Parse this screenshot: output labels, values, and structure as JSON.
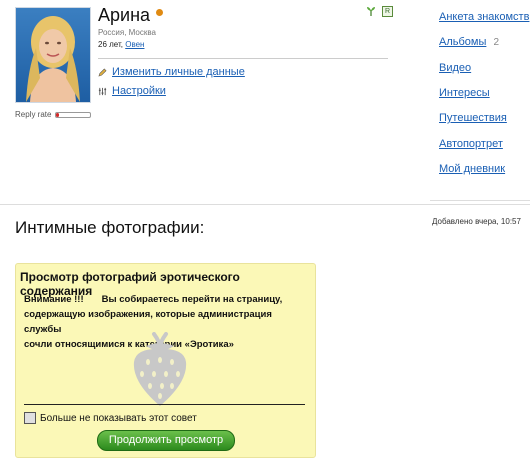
{
  "profile": {
    "name": "Арина",
    "location": "Россия, Москва",
    "age_prefix": "26 лет,",
    "zodiac": "Овен",
    "reply_rate_label": "Reply rate",
    "reply_rate_fraction": 0.06,
    "badge_r": "R",
    "actions": [
      {
        "label": "Изменить личные данные",
        "icon": "pencil-icon"
      },
      {
        "label": "Настройки",
        "icon": "settings-icon"
      }
    ]
  },
  "side_menu": [
    {
      "label": "Анкета знакомств"
    },
    {
      "label": "Альбомы",
      "count": "2"
    },
    {
      "label": "Видео"
    },
    {
      "label": "Интересы"
    },
    {
      "label": "Путешествия"
    },
    {
      "label": "Автопортрет"
    },
    {
      "label": "Мой дневник"
    }
  ],
  "section": {
    "title": "Интимные фотографии:",
    "added": "Добавлено вчера, 10:57"
  },
  "warning": {
    "title": "Просмотр фотографий эротического содержания",
    "label": "Внимание !!!",
    "text_1": "Вы собираетесь перейти на страницу,",
    "text_2": "содержащую изображения, которые администрация службы",
    "text_3": "сочли относящимися к категории «Эротика»",
    "dont_show": "Больше не показывать этот совет",
    "continue": "Продолжить просмотр"
  },
  "colors": {
    "link": "#1a5fb4",
    "warning_bg": "#fbf8b7",
    "button_green": "#3a9a28",
    "online": "#e08a12"
  }
}
